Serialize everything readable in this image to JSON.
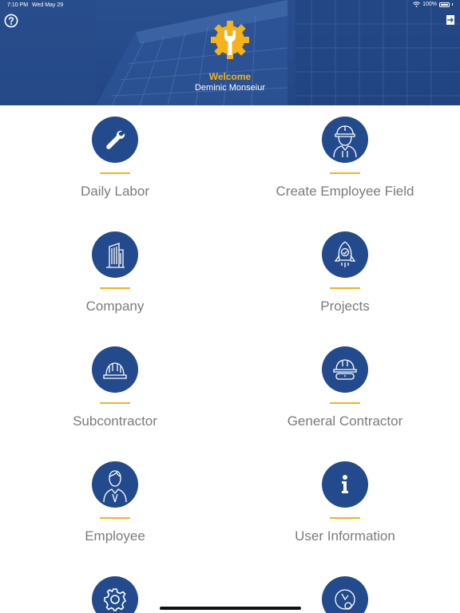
{
  "status_bar": {
    "time": "7:10 PM",
    "date": "Wed May 29",
    "battery": "100%"
  },
  "header": {
    "welcome": "Welcome",
    "username": "Deminic Monseiur"
  },
  "colors": {
    "header_blue": "#234785",
    "accent": "#f5b21b",
    "icon_circle": "#234a8c",
    "label_gray": "#7b7b7b"
  },
  "menu": [
    {
      "label": "Daily Labor",
      "icon": "wrench-icon"
    },
    {
      "label": "Create Employee Field",
      "icon": "hard-hat-worker-icon"
    },
    {
      "label": "Company",
      "icon": "office-building-icon"
    },
    {
      "label": "Projects",
      "icon": "rocket-icon"
    },
    {
      "label": "Subcontractor",
      "icon": "hard-hat-icon"
    },
    {
      "label": "General Contractor",
      "icon": "helmet-goggles-icon"
    },
    {
      "label": "Employee",
      "icon": "person-icon"
    },
    {
      "label": "User Information",
      "icon": "info-icon"
    },
    {
      "label": "",
      "icon": "settings-gear-icon"
    },
    {
      "label": "",
      "icon": "clock-gear-icon"
    }
  ]
}
